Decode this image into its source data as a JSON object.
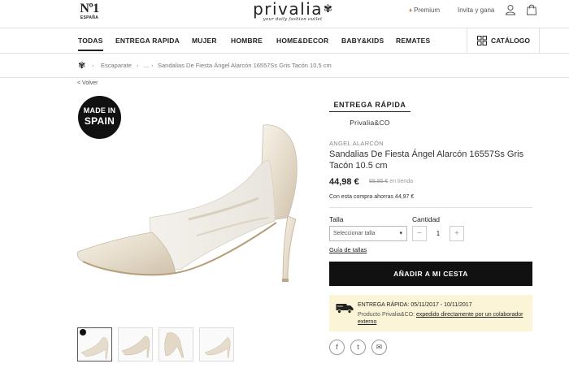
{
  "header": {
    "badge_big": "Nº1",
    "badge_small": "ESPAÑA",
    "logo_name": "privalia",
    "logo_tagline": "your daily fashion outlet",
    "premium_label": "Premium",
    "invite_label": "Invita y gana"
  },
  "nav": {
    "items": [
      {
        "label": "TODAS",
        "active": true
      },
      {
        "label": "ENTREGA RAPIDA"
      },
      {
        "label": "MUJER"
      },
      {
        "label": "HOMBRE"
      },
      {
        "label": "HOME&DECOR"
      },
      {
        "label": "BABY&KIDS"
      },
      {
        "label": "REMATES"
      }
    ],
    "catalog_label": "CATÁLOGO"
  },
  "breadcrumb": {
    "items": [
      "Escaparate",
      "...",
      "Sandalias De Fiesta Ángel Alarcón 16557Ss Gris Tacón 10,5 cm"
    ]
  },
  "back_label": "< Volver",
  "badge_made_in": {
    "line1": "MADE IN",
    "line2": "SPAIN"
  },
  "product": {
    "campaign_title": "ENTREGA RÁPIDA",
    "campaign_sub": "Privalia&CO",
    "brand": "ANGEL ALARCÓN",
    "title": "Sandalias De Fiesta Ángel Alarcón 16557Ss Gris Tacón 10.5 cm",
    "price": "44,98 €",
    "old_price": "89,95 €",
    "old_price_suffix": "en tienda",
    "savings": "Con esta compra ahorras 44,97 €",
    "size_label": "Talla",
    "size_placeholder": "Seleccionar talla",
    "qty_label": "Cantidad",
    "qty_value": "1",
    "size_guide": "Guía de tallas",
    "add_to_cart": "AÑADIR A MI CESTA",
    "delivery_line1": "ENTREGA RÁPIDA: 05/11/2017 - 10/11/2017",
    "delivery_prefix": "Producto Privalia&CO:",
    "delivery_link": "expedido directamente por un colaborador externo"
  },
  "colors": {
    "accent": "#111111",
    "delivery_bg": "#fbf4d6",
    "shoe": "#e8dfcf"
  }
}
